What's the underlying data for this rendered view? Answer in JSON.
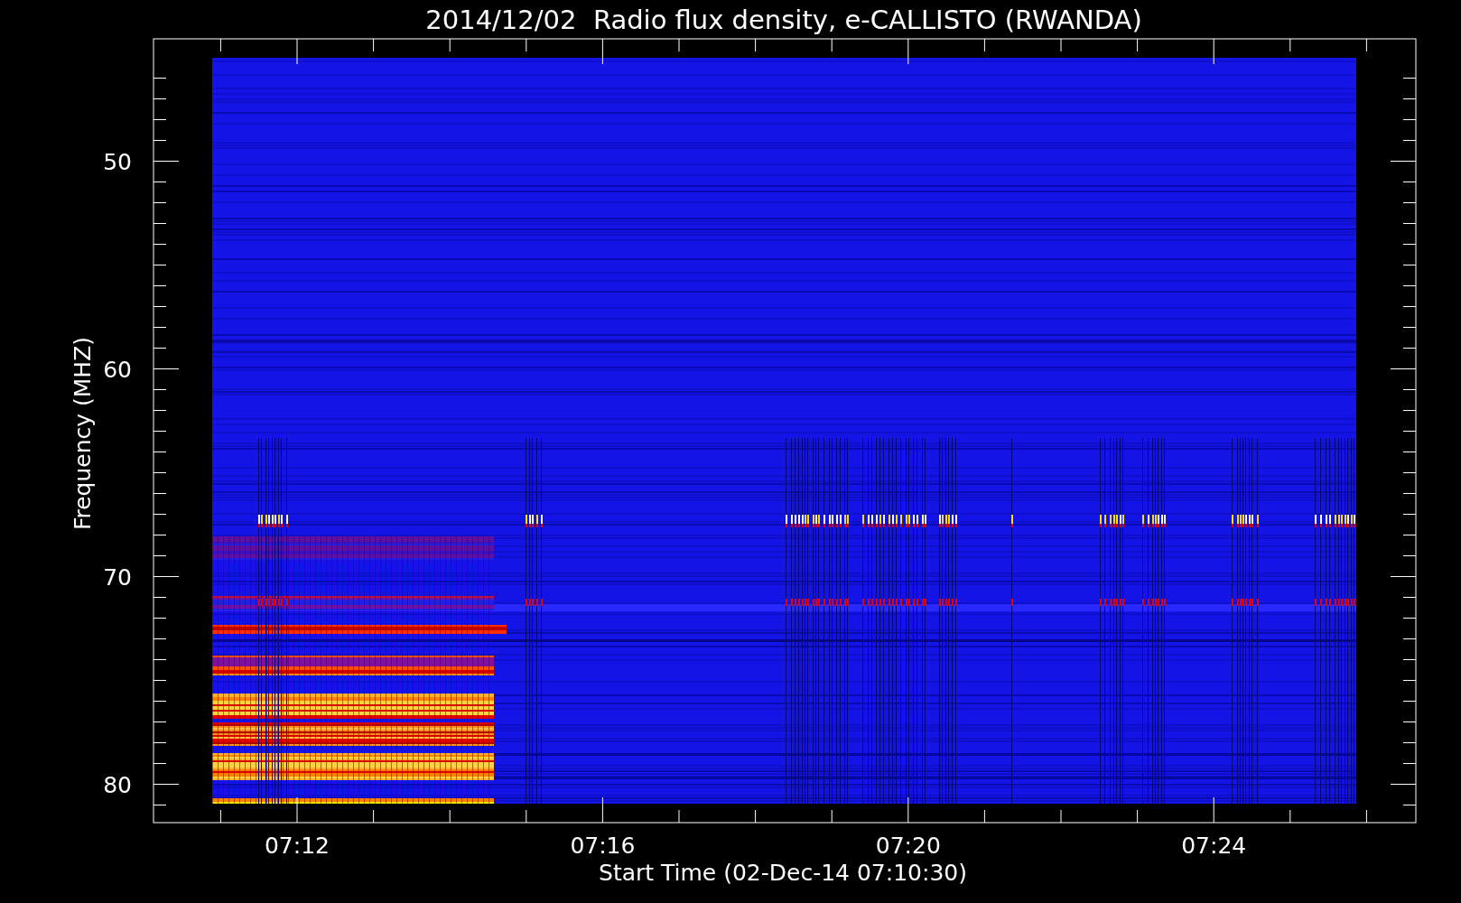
{
  "plot": {
    "title": "2014/12/02  Radio flux density, e-CALLISTO (RWANDA)",
    "xlabel": "Start Time (02-Dec-14 07:10:30)",
    "ylabel": "Frequency (MHZ)",
    "xticks": [
      "07:12",
      "07:16",
      "07:20",
      "07:24"
    ],
    "yticks": [
      "50",
      "60",
      "70",
      "80"
    ]
  }
}
